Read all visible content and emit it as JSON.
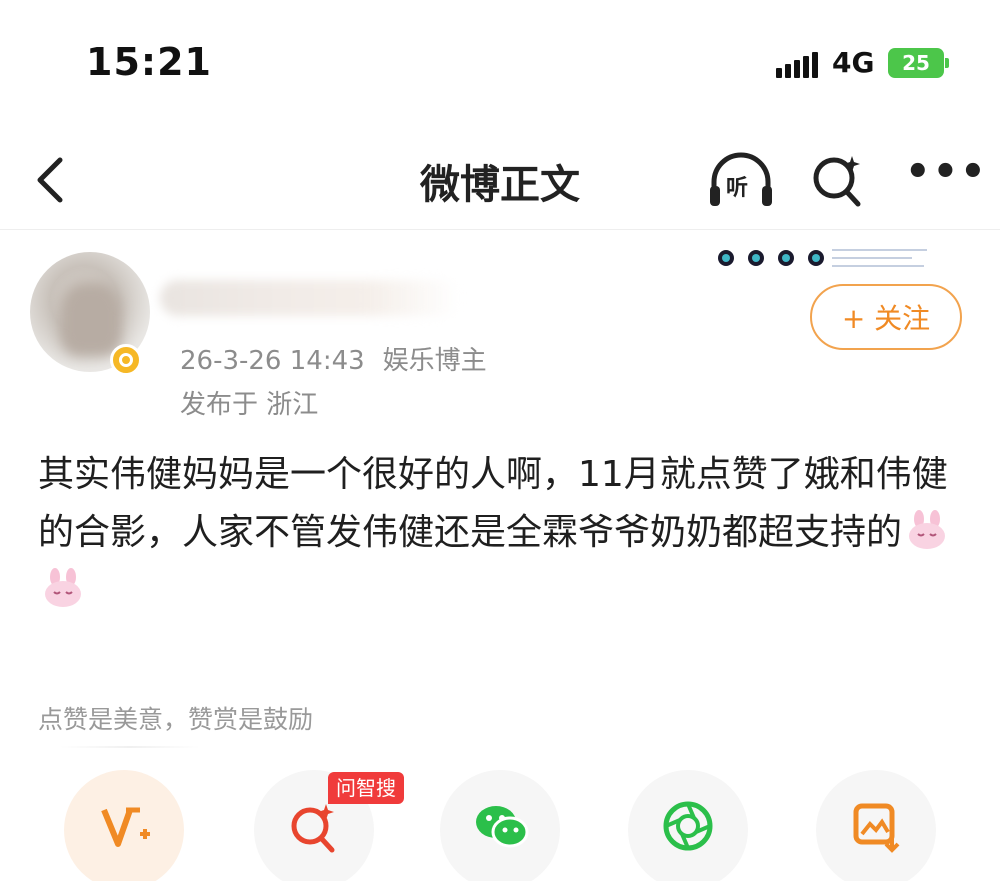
{
  "status_bar": {
    "time": "15:21",
    "network": "4G",
    "battery": "25"
  },
  "nav": {
    "title": "微博正文",
    "listen_label": "听",
    "more_label": "•••"
  },
  "author": {
    "date": "26-3-26 14:43",
    "tag": "娱乐博主",
    "location": "发布于 浙江",
    "follow_label": "+ 关注"
  },
  "post": {
    "text": "其实伟健妈妈是一个很好的人啊，11月就点赞了娥和伟健的合影，人家不管发伟健还是全霖爷爷奶奶都超支持的",
    "emojis": [
      "bunny-emoji",
      "bunny-emoji"
    ]
  },
  "reward_hint": "点赞是美意，赞赏是鼓励",
  "actions": {
    "ask_badge": "问智搜",
    "items": [
      "v-plus-icon",
      "smart-search-icon",
      "wechat-icon",
      "moments-icon",
      "save-image-icon"
    ]
  },
  "colors": {
    "accent": "#f08a24",
    "verified": "#f6b826",
    "battery": "#4cc64a",
    "badge": "#f03b3b"
  }
}
